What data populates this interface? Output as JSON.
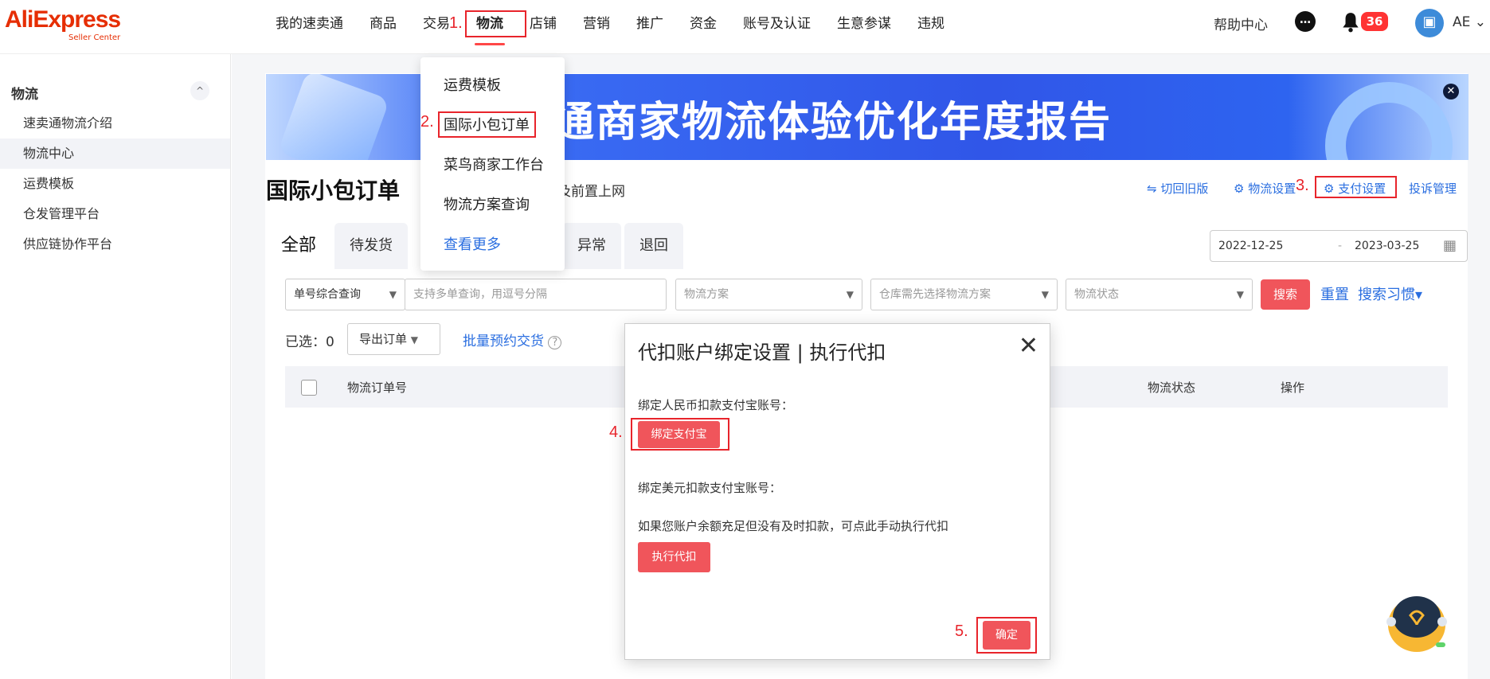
{
  "logo": {
    "brand": "AliExpress",
    "sub": "Seller Center"
  },
  "nav": {
    "items": [
      "我的速卖通",
      "商品",
      "交易",
      "物流",
      "店铺",
      "营销",
      "推广",
      "资金",
      "账号及认证",
      "生意参谋",
      "违规"
    ]
  },
  "header_right": {
    "help": "帮助中心",
    "badge": "36",
    "user": "AE"
  },
  "steps": {
    "s1": "1.",
    "s2": "2.",
    "s3": "3.",
    "s4": "4.",
    "s5": "5."
  },
  "sidebar": {
    "title": "物流",
    "items": [
      "速卖通物流介绍",
      "物流中心",
      "运费模板",
      "仓发管理平台",
      "供应链协作平台"
    ]
  },
  "banner": {
    "text": "通商家物流体验优化年度报告"
  },
  "page": {
    "title": "国际小包订单",
    "note": "及前置上网",
    "links": {
      "old": "⇋ 切回旧版",
      "logistics_settings": "物流设置",
      "pay_settings": "支付设置",
      "complaints": "投诉管理"
    }
  },
  "dropdown": {
    "items": [
      "运费模板",
      "国际小包订单",
      "菜鸟商家工作台",
      "物流方案查询",
      "查看更多"
    ]
  },
  "tabs": [
    "全部",
    "待发货",
    "异常",
    "退回"
  ],
  "date": {
    "start": "2022-12-25",
    "sep": "-",
    "end": "2023-03-25"
  },
  "filters": {
    "query_type": "单号综合查询",
    "query_placeholder": "支持多单查询，用逗号分隔",
    "plan": "物流方案",
    "warehouse": "仓库需先选择物流方案",
    "status": "物流状态",
    "search": "搜索",
    "reset": "重置",
    "habit": "搜索习惯"
  },
  "toolbar": {
    "selected_label": "已选：",
    "selected_count": "0",
    "export": "导出订单",
    "batch": "批量预约交货"
  },
  "table": {
    "col_order": "物流订单号",
    "col_status": "物流状态",
    "col_action": "操作"
  },
  "modal": {
    "title": "代扣账户绑定设置 | 执行代扣",
    "cny_label": "绑定人民币扣款支付宝账号：",
    "bind_btn": "绑定支付宝",
    "usd_label": "绑定美元扣款支付宝账号：",
    "hint": "如果您账户余额充足但没有及时扣款，可点此手动执行代扣",
    "exec_btn": "执行代扣",
    "ok_btn": "确定"
  }
}
